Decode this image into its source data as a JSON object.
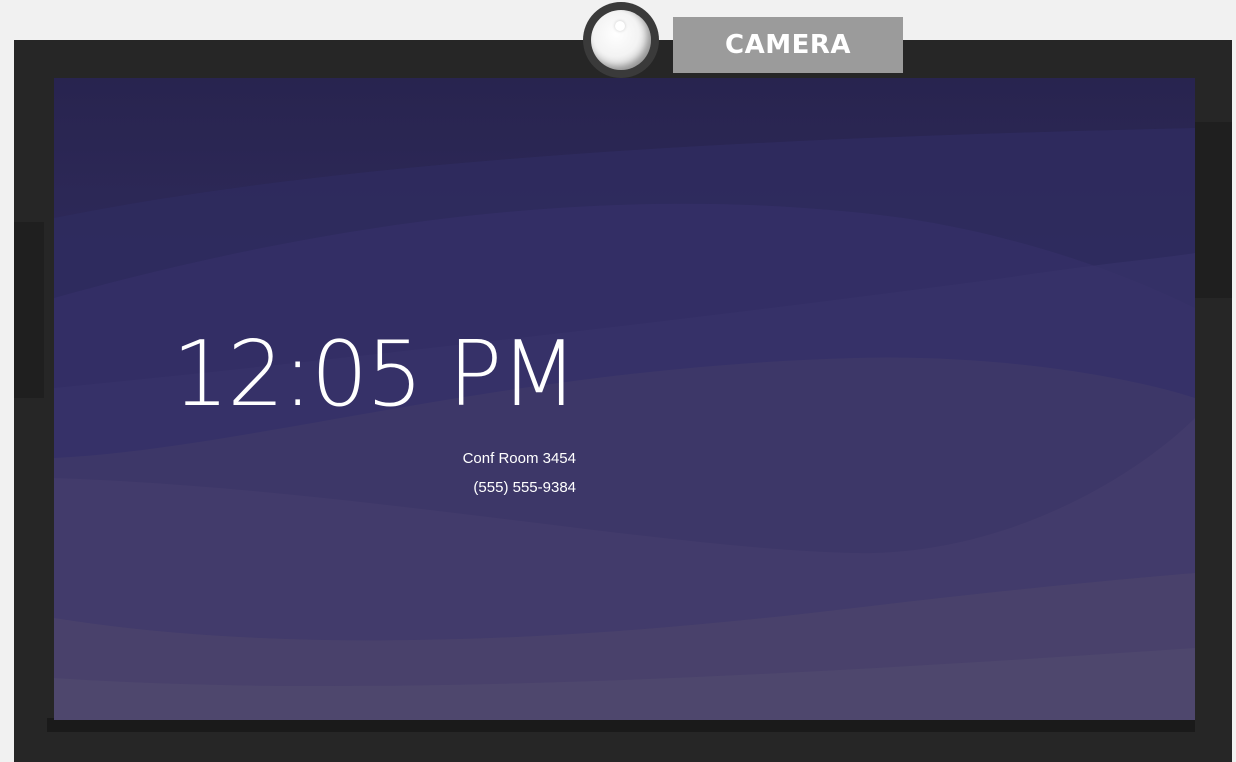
{
  "labels": {
    "camera": "CAMERA"
  },
  "display": {
    "time": "12:05 PM",
    "room_name": "Conf Room 3454",
    "phone": "(555) 555-9384"
  },
  "colors": {
    "page_background": "#f1f1f1",
    "bezel": "#262626",
    "screen_top": "#2a2752",
    "screen_bottom": "#4d4666",
    "camera_tag": "#9b9b9b",
    "text": "#ffffff"
  },
  "icons": {
    "camera": "camera-lens-icon"
  }
}
